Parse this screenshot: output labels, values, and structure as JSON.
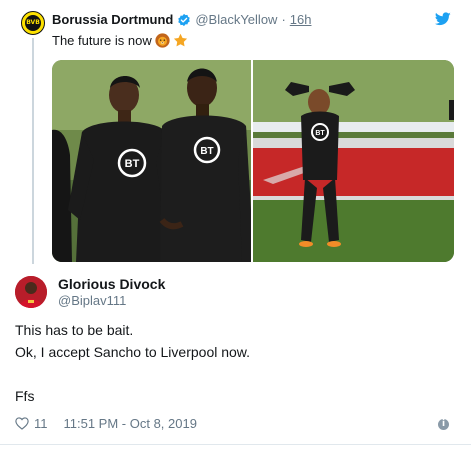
{
  "quoted_tweet": {
    "avatar_text": "BVB",
    "name": "Borussia Dortmund",
    "handle": "@BlackYellow",
    "separator": "·",
    "time": "16h",
    "text": "The future is now",
    "emoji_names": [
      "lion-emoji",
      "star-emoji"
    ],
    "media": [
      {
        "name": "photo-players-training",
        "logo_text": "BT"
      },
      {
        "name": "photo-player-stretching",
        "logo_text": "BT"
      }
    ]
  },
  "reply_tweet": {
    "name": "Glorious Divock",
    "handle": "@Biplav111",
    "lines": [
      "This has to be bait.",
      "Ok, I accept Sancho to Liverpool now.",
      "Ffs"
    ],
    "likes": "11",
    "timestamp": "11:51 PM - Oct 8, 2019",
    "info_symbol": "i"
  },
  "colors": {
    "text": "#14171a",
    "secondary": "#657786",
    "verified": "#1da1f2",
    "twitter_bird": "#1da1f2",
    "bvb_yellow": "#fde100",
    "liverpool_red": "#c8102e"
  },
  "icons": [
    "verified-badge-icon",
    "twitter-bird-icon",
    "heart-icon",
    "info-icon"
  ]
}
